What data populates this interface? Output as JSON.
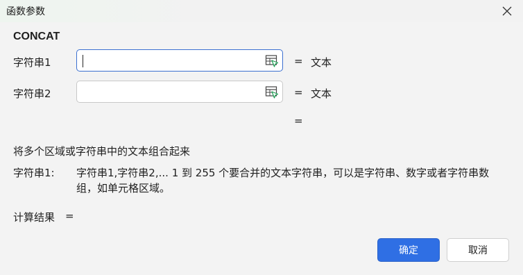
{
  "window": {
    "title": "函数参数"
  },
  "function": {
    "name": "CONCAT"
  },
  "args": [
    {
      "label": "字符串1",
      "value": "",
      "type_hint": "文本"
    },
    {
      "label": "字符串2",
      "value": "",
      "type_hint": "文本"
    }
  ],
  "eq_sign": "=",
  "formula_result_eq": "=",
  "description": "将多个区域或字符串中的文本组合起来",
  "help": {
    "label": "字符串1:",
    "text": "字符串1,字符串2,... 1 到 255 个要合并的文本字符串，可以是字符串、数字或者字符串数组，如单元格区域。"
  },
  "result": {
    "label": "计算结果",
    "eq": "="
  },
  "buttons": {
    "ok": "确定",
    "cancel": "取消"
  },
  "colors": {
    "accent": "#2f6fe4",
    "focus_border": "#3b6fd0",
    "icon_green": "#1e9e54"
  }
}
